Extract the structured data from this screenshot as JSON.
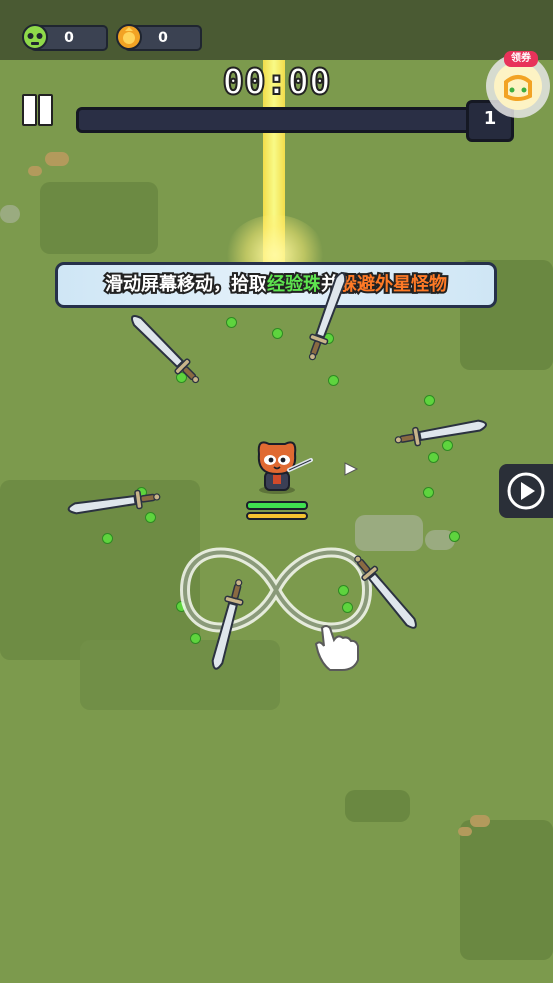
{
  "hud": {
    "kill_count": "0",
    "coin_count": "0",
    "timer": "00:00",
    "level": "1",
    "coupon_label": "领券"
  },
  "tutorial": {
    "part1": "滑动屏幕移动，拾取",
    "part2": "经验珠",
    "part3": "并",
    "part4": "躲避外星怪物"
  },
  "player": {
    "hp_fraction": 1.0,
    "exp_fraction": 1.0
  },
  "xp_progress": 0,
  "icons": {
    "kill": "alien-skull-icon",
    "coin": "coin-bag-icon",
    "pause": "pause-icon",
    "play": "play-icon",
    "coupon": "gift-coupon-icon",
    "gesture": "infinity-swipe-hand-icon"
  },
  "colors": {
    "grass": "#7c9a4d",
    "gem": "#5ed43e",
    "hp": "#3fe04f",
    "exp": "#f5c330",
    "beam": "#f8e04a"
  }
}
